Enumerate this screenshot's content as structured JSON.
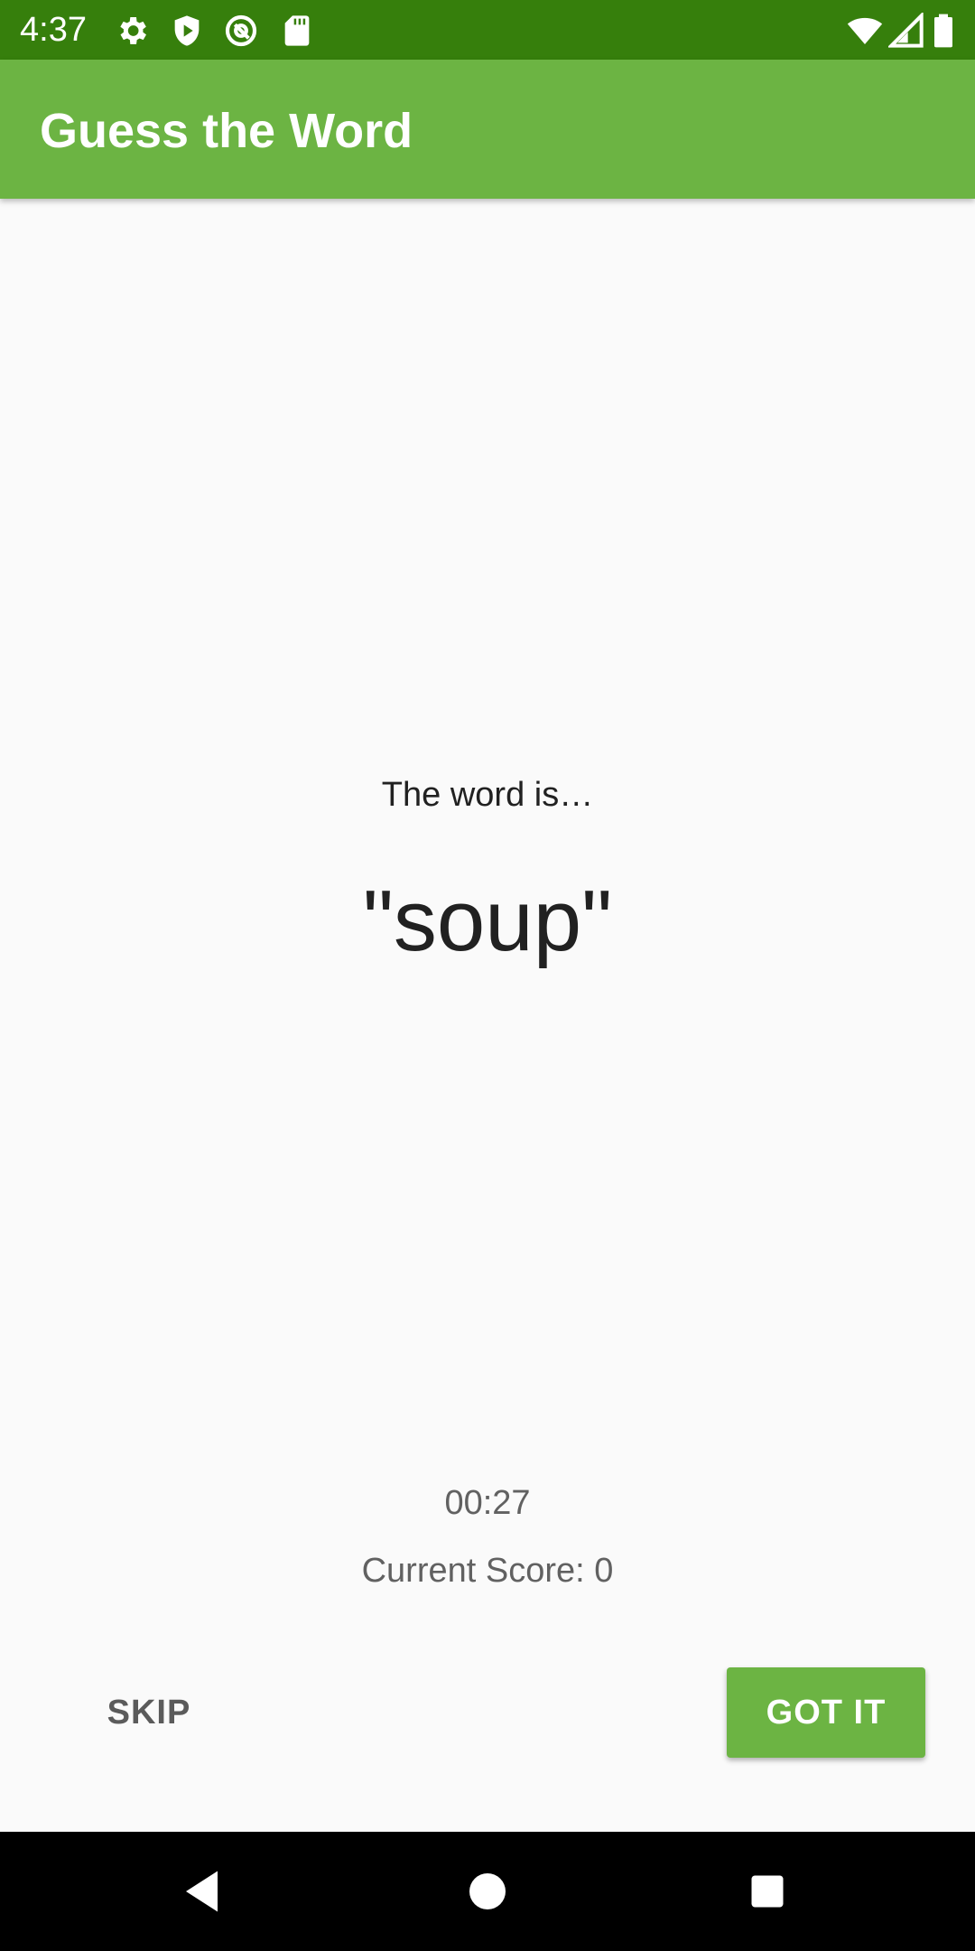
{
  "status_bar": {
    "time": "4:37",
    "icons_left": [
      "settings-icon",
      "shield-icon",
      "at-sign-icon",
      "sd-card-icon"
    ],
    "icons_right": [
      "wifi-icon",
      "signal-icon",
      "battery-icon"
    ]
  },
  "app_bar": {
    "title": "Guess the Word"
  },
  "game": {
    "word_label": "The word is…",
    "word": "\"soup\"",
    "timer": "00:27",
    "score_text": "Current Score: 0"
  },
  "actions": {
    "skip_label": "SKIP",
    "got_it_label": "GOT IT"
  },
  "nav_bar": {
    "buttons": [
      "back-icon",
      "home-icon",
      "recents-icon"
    ]
  },
  "colors": {
    "status_bar": "#367f0c",
    "app_bar": "#6cb443",
    "accent": "#6cb443",
    "background": "#fafafa"
  }
}
